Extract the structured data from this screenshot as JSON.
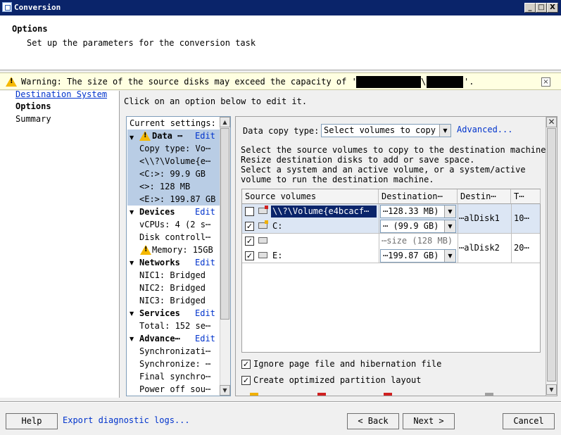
{
  "window": {
    "title": "Conversion",
    "controls": [
      "_",
      "□",
      "X"
    ]
  },
  "header": {
    "title": "Options",
    "subtitle": "Set up the parameters for the conversion task"
  },
  "warning": {
    "prefix": "Warning: The size of the source disks may exceed the capacity of '\\\\",
    "middle": "\\",
    "suffix": "'."
  },
  "nav": {
    "items": [
      "Destination System",
      "Options",
      "Summary"
    ]
  },
  "instruction": "Click on an option below to edit it.",
  "settings": {
    "heading": "Current settings:",
    "edit_label": "Edit",
    "sections": [
      {
        "title": "Data ⋯",
        "details": [
          "Copy type: Vo⋯",
          "<\\\\?\\Volume{e⋯",
          "<C:>: 99.9 GB",
          "<>: 128 MB",
          "<E:>: 199.87 GB"
        ]
      },
      {
        "title": "Devices",
        "details": [
          "vCPUs: 4 (2 s⋯",
          "Disk controll⋯",
          "Memory: 15GB"
        ]
      },
      {
        "title": "Networks",
        "details": [
          "NIC1: Bridged",
          "NIC2: Bridged",
          "NIC3: Bridged"
        ]
      },
      {
        "title": "Services",
        "details": [
          "Total: 152 se⋯"
        ]
      },
      {
        "title": "Advance⋯",
        "details": [
          "Synchronizati⋯",
          "Synchronize: ⋯",
          "Final synchro⋯",
          "Power off sou⋯"
        ]
      }
    ]
  },
  "panel": {
    "copy_type_label": "Data copy type:",
    "copy_type_value": "Select volumes to copy",
    "advanced_link": "Advanced...",
    "description": [
      "Select the source volumes to copy to the destination machine.",
      "Resize destination disks to add or save space.",
      "Select a system and an active volume, or a system/active",
      "volume to run the destination machine."
    ],
    "table": {
      "headers": [
        "Source volumes",
        "Destination⋯",
        "Destin⋯",
        "T⋯"
      ],
      "rows": [
        {
          "checked": false,
          "source": "\\\\?\\Volume{e4bcacf⋯",
          "dest": "⋯128.33 MB)"
        },
        {
          "checked": true,
          "source": "C:",
          "dest": "⋯ (99.9 GB)"
        },
        {
          "checked": true,
          "source": "",
          "dest": "⋯size (128 MB)"
        },
        {
          "checked": true,
          "source": "E:",
          "dest": "⋯199.87 GB)"
        }
      ],
      "groups": [
        {
          "disk": "⋯alDisk1",
          "type": "10⋯"
        },
        {
          "disk": "⋯alDisk2",
          "type": "20⋯"
        }
      ]
    },
    "options": [
      {
        "label": "Ignore page file and hibernation file",
        "checked": true
      },
      {
        "label": "Create optimized partition layout",
        "checked": true
      }
    ]
  },
  "footer": {
    "help": "Help",
    "export": "Export diagnostic logs...",
    "back": "< Back",
    "next": "Next >",
    "cancel": "Cancel"
  }
}
